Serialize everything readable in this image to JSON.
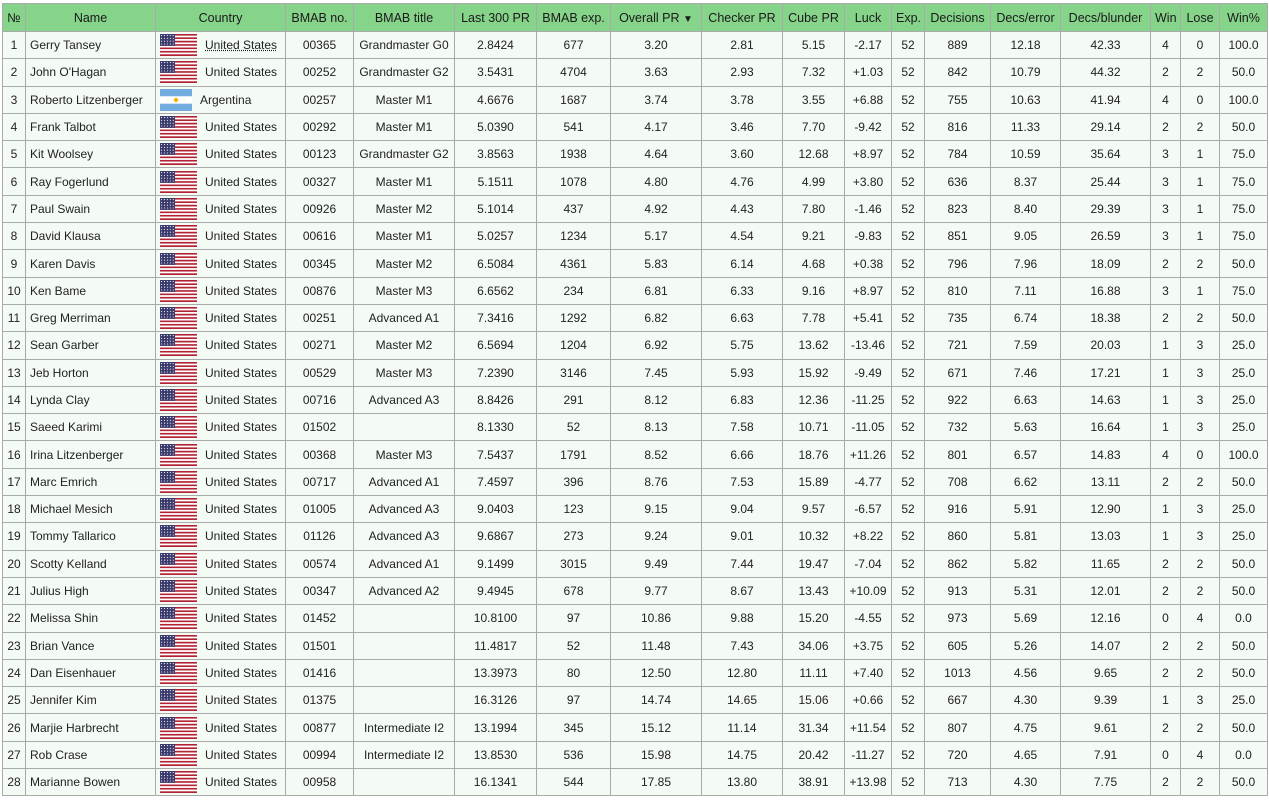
{
  "columns": [
    "№",
    "Name",
    "Country",
    "BMAB no.",
    "BMAB title",
    "Last 300 PR",
    "BMAB exp.",
    "Overall PR",
    "Checker PR",
    "Cube PR",
    "Luck",
    "Exp.",
    "Decisions",
    "Decs/error",
    "Decs/blunder",
    "Win",
    "Lose",
    "Win%"
  ],
  "sort_indicator": "▼",
  "flag_colors": {
    "us_red": "#b22234",
    "us_blue": "#3c3b6e",
    "ar_blue": "#74acdf",
    "ar_sun": "#f6b40e"
  },
  "rows": [
    [
      "1",
      "Gerry Tansey",
      "United States",
      "00365",
      "Grandmaster G0",
      "2.8424",
      "677",
      "3.20",
      "2.81",
      "5.15",
      "-2.17",
      "52",
      "889",
      "12.18",
      "42.33",
      "4",
      "0",
      "100.0"
    ],
    [
      "2",
      "John O'Hagan",
      "United States",
      "00252",
      "Grandmaster G2",
      "3.5431",
      "4704",
      "3.63",
      "2.93",
      "7.32",
      "+1.03",
      "52",
      "842",
      "10.79",
      "44.32",
      "2",
      "2",
      "50.0"
    ],
    [
      "3",
      "Roberto Litzenberger",
      "Argentina",
      "00257",
      "Master M1",
      "4.6676",
      "1687",
      "3.74",
      "3.78",
      "3.55",
      "+6.88",
      "52",
      "755",
      "10.63",
      "41.94",
      "4",
      "0",
      "100.0"
    ],
    [
      "4",
      "Frank Talbot",
      "United States",
      "00292",
      "Master M1",
      "5.0390",
      "541",
      "4.17",
      "3.46",
      "7.70",
      "-9.42",
      "52",
      "816",
      "11.33",
      "29.14",
      "2",
      "2",
      "50.0"
    ],
    [
      "5",
      "Kit Woolsey",
      "United States",
      "00123",
      "Grandmaster G2",
      "3.8563",
      "1938",
      "4.64",
      "3.60",
      "12.68",
      "+8.97",
      "52",
      "784",
      "10.59",
      "35.64",
      "3",
      "1",
      "75.0"
    ],
    [
      "6",
      "Ray Fogerlund",
      "United States",
      "00327",
      "Master M1",
      "5.1511",
      "1078",
      "4.80",
      "4.76",
      "4.99",
      "+3.80",
      "52",
      "636",
      "8.37",
      "25.44",
      "3",
      "1",
      "75.0"
    ],
    [
      "7",
      "Paul Swain",
      "United States",
      "00926",
      "Master M2",
      "5.1014",
      "437",
      "4.92",
      "4.43",
      "7.80",
      "-1.46",
      "52",
      "823",
      "8.40",
      "29.39",
      "3",
      "1",
      "75.0"
    ],
    [
      "8",
      "David Klausa",
      "United States",
      "00616",
      "Master M1",
      "5.0257",
      "1234",
      "5.17",
      "4.54",
      "9.21",
      "-9.83",
      "52",
      "851",
      "9.05",
      "26.59",
      "3",
      "1",
      "75.0"
    ],
    [
      "9",
      "Karen Davis",
      "United States",
      "00345",
      "Master M2",
      "6.5084",
      "4361",
      "5.83",
      "6.14",
      "4.68",
      "+0.38",
      "52",
      "796",
      "7.96",
      "18.09",
      "2",
      "2",
      "50.0"
    ],
    [
      "10",
      "Ken Bame",
      "United States",
      "00876",
      "Master M3",
      "6.6562",
      "234",
      "6.81",
      "6.33",
      "9.16",
      "+8.97",
      "52",
      "810",
      "7.11",
      "16.88",
      "3",
      "1",
      "75.0"
    ],
    [
      "11",
      "Greg Merriman",
      "United States",
      "00251",
      "Advanced A1",
      "7.3416",
      "1292",
      "6.82",
      "6.63",
      "7.78",
      "+5.41",
      "52",
      "735",
      "6.74",
      "18.38",
      "2",
      "2",
      "50.0"
    ],
    [
      "12",
      "Sean Garber",
      "United States",
      "00271",
      "Master M2",
      "6.5694",
      "1204",
      "6.92",
      "5.75",
      "13.62",
      "-13.46",
      "52",
      "721",
      "7.59",
      "20.03",
      "1",
      "3",
      "25.0"
    ],
    [
      "13",
      "Jeb Horton",
      "United States",
      "00529",
      "Master M3",
      "7.2390",
      "3146",
      "7.45",
      "5.93",
      "15.92",
      "-9.49",
      "52",
      "671",
      "7.46",
      "17.21",
      "1",
      "3",
      "25.0"
    ],
    [
      "14",
      "Lynda Clay",
      "United States",
      "00716",
      "Advanced A3",
      "8.8426",
      "291",
      "8.12",
      "6.83",
      "12.36",
      "-11.25",
      "52",
      "922",
      "6.63",
      "14.63",
      "1",
      "3",
      "25.0"
    ],
    [
      "15",
      "Saeed Karimi",
      "United States",
      "01502",
      "",
      "8.1330",
      "52",
      "8.13",
      "7.58",
      "10.71",
      "-11.05",
      "52",
      "732",
      "5.63",
      "16.64",
      "1",
      "3",
      "25.0"
    ],
    [
      "16",
      "Irina Litzenberger",
      "United States",
      "00368",
      "Master M3",
      "7.5437",
      "1791",
      "8.52",
      "6.66",
      "18.76",
      "+11.26",
      "52",
      "801",
      "6.57",
      "14.83",
      "4",
      "0",
      "100.0"
    ],
    [
      "17",
      "Marc Emrich",
      "United States",
      "00717",
      "Advanced A1",
      "7.4597",
      "396",
      "8.76",
      "7.53",
      "15.89",
      "-4.77",
      "52",
      "708",
      "6.62",
      "13.11",
      "2",
      "2",
      "50.0"
    ],
    [
      "18",
      "Michael Mesich",
      "United States",
      "01005",
      "Advanced A3",
      "9.0403",
      "123",
      "9.15",
      "9.04",
      "9.57",
      "-6.57",
      "52",
      "916",
      "5.91",
      "12.90",
      "1",
      "3",
      "25.0"
    ],
    [
      "19",
      "Tommy Tallarico",
      "United States",
      "01126",
      "Advanced A3",
      "9.6867",
      "273",
      "9.24",
      "9.01",
      "10.32",
      "+8.22",
      "52",
      "860",
      "5.81",
      "13.03",
      "1",
      "3",
      "25.0"
    ],
    [
      "20",
      "Scotty Kelland",
      "United States",
      "00574",
      "Advanced A1",
      "9.1499",
      "3015",
      "9.49",
      "7.44",
      "19.47",
      "-7.04",
      "52",
      "862",
      "5.82",
      "11.65",
      "2",
      "2",
      "50.0"
    ],
    [
      "21",
      "Julius High",
      "United States",
      "00347",
      "Advanced A2",
      "9.4945",
      "678",
      "9.77",
      "8.67",
      "13.43",
      "+10.09",
      "52",
      "913",
      "5.31",
      "12.01",
      "2",
      "2",
      "50.0"
    ],
    [
      "22",
      "Melissa Shin",
      "United States",
      "01452",
      "",
      "10.8100",
      "97",
      "10.86",
      "9.88",
      "15.20",
      "-4.55",
      "52",
      "973",
      "5.69",
      "12.16",
      "0",
      "4",
      "0.0"
    ],
    [
      "23",
      "Brian Vance",
      "United States",
      "01501",
      "",
      "11.4817",
      "52",
      "11.48",
      "7.43",
      "34.06",
      "+3.75",
      "52",
      "605",
      "5.26",
      "14.07",
      "2",
      "2",
      "50.0"
    ],
    [
      "24",
      "Dan Eisenhauer",
      "United States",
      "01416",
      "",
      "13.3973",
      "80",
      "12.50",
      "12.80",
      "11.11",
      "+7.40",
      "52",
      "1013",
      "4.56",
      "9.65",
      "2",
      "2",
      "50.0"
    ],
    [
      "25",
      "Jennifer Kim",
      "United States",
      "01375",
      "",
      "16.3126",
      "97",
      "14.74",
      "14.65",
      "15.06",
      "+0.66",
      "52",
      "667",
      "4.30",
      "9.39",
      "1",
      "3",
      "25.0"
    ],
    [
      "26",
      "Marjie Harbrecht",
      "United States",
      "00877",
      "Intermediate I2",
      "13.1994",
      "345",
      "15.12",
      "11.14",
      "31.34",
      "+11.54",
      "52",
      "807",
      "4.75",
      "9.61",
      "2",
      "2",
      "50.0"
    ],
    [
      "27",
      "Rob Crase",
      "United States",
      "00994",
      "Intermediate I2",
      "13.8530",
      "536",
      "15.98",
      "14.75",
      "20.42",
      "-11.27",
      "52",
      "720",
      "4.65",
      "7.91",
      "0",
      "4",
      "0.0"
    ],
    [
      "28",
      "Marianne Bowen",
      "United States",
      "00958",
      "",
      "16.1341",
      "544",
      "17.85",
      "13.80",
      "38.91",
      "+13.98",
      "52",
      "713",
      "4.30",
      "7.75",
      "2",
      "2",
      "50.0"
    ]
  ]
}
